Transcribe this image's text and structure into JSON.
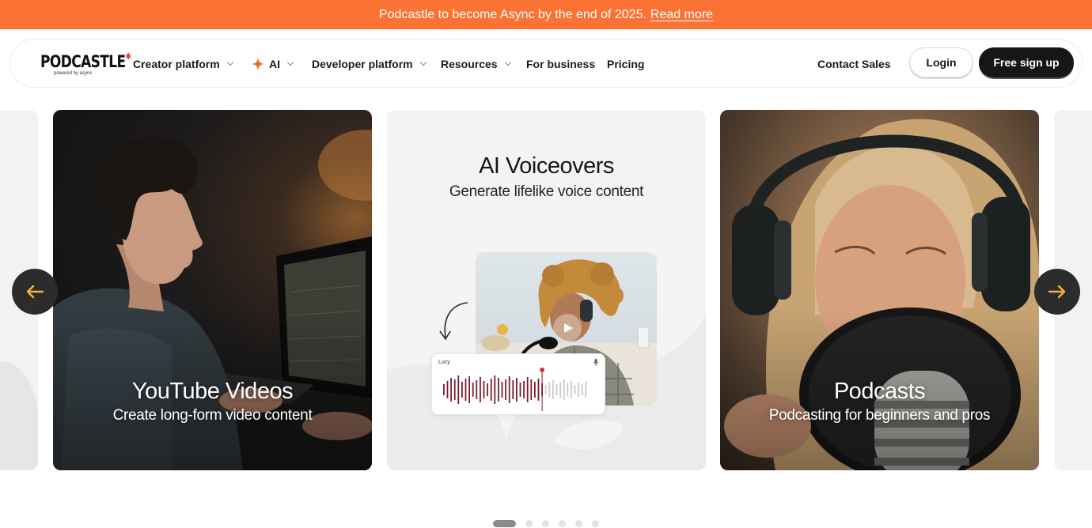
{
  "announcement": {
    "text": "Podcastle to become Async by the end of 2025.",
    "link_label": "Read more"
  },
  "brand": {
    "logo_text": "PODCASTLE",
    "logo_subtext": "powered by async",
    "accent_color": "#fa7234"
  },
  "nav": {
    "items": [
      {
        "label": "Creator platform",
        "has_dropdown": true
      },
      {
        "label": "AI",
        "has_dropdown": true,
        "icon": "sparkle-icon"
      },
      {
        "label": "Developer platform",
        "has_dropdown": true
      },
      {
        "label": "Resources",
        "has_dropdown": true
      },
      {
        "label": "For business",
        "has_dropdown": false
      },
      {
        "label": "Pricing",
        "has_dropdown": false
      }
    ],
    "contact_label": "Contact Sales",
    "login_label": "Login",
    "signup_label": "Free sign up"
  },
  "carousel": {
    "cards": [
      {
        "title": "YouTube Videos",
        "subtitle": "Create long-form video content"
      },
      {
        "title": "AI Voiceovers",
        "subtitle": "Generate lifelike voice content",
        "voice_name": "Lucy"
      },
      {
        "title": "Podcasts",
        "subtitle": "Podcasting for beginners and pros"
      }
    ],
    "prev_icon": "arrow-left-icon",
    "next_icon": "arrow-right-icon",
    "page_count": 6,
    "active_page": 1
  }
}
